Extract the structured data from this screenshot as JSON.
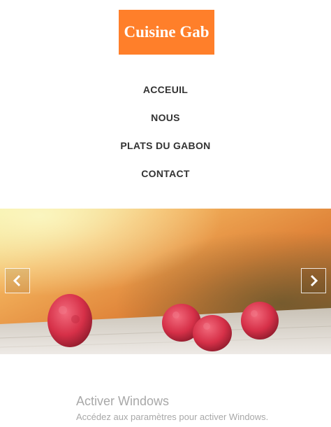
{
  "brand": {
    "name": "Cuisine Gab",
    "color": "#ff7f2a"
  },
  "nav": {
    "items": [
      {
        "label": "ACCEUIL"
      },
      {
        "label": "NOUS"
      },
      {
        "label": "PLATS DU GABON"
      },
      {
        "label": "CONTACT"
      }
    ]
  },
  "carousel": {
    "image": "raspberries-on-wooden-table",
    "prev_icon": "chevron-left-icon",
    "next_icon": "chevron-right-icon"
  },
  "watermark": {
    "title": "Activer Windows",
    "subtitle": "Accédez aux paramètres pour activer Windows."
  }
}
